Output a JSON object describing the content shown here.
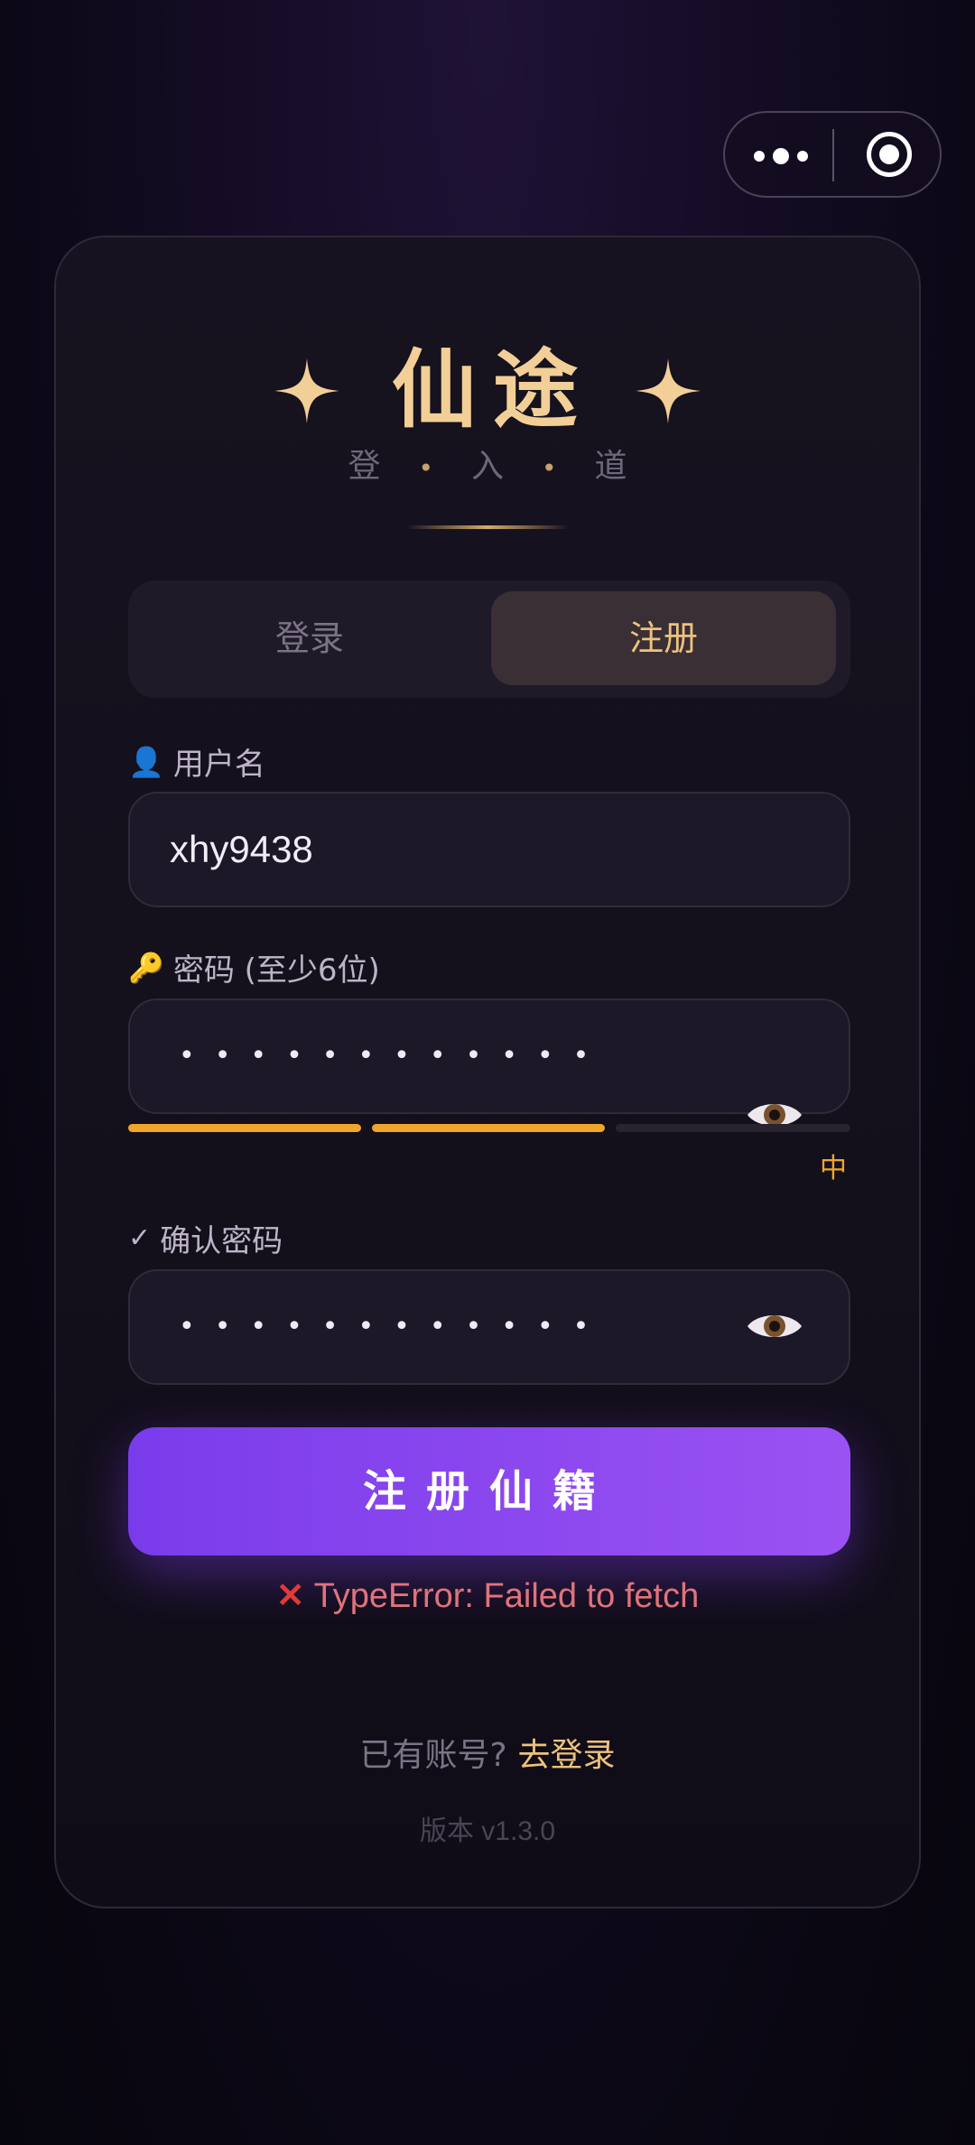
{
  "title": "仙途",
  "subtitle": [
    "登",
    "入",
    "道"
  ],
  "tabs": {
    "login": "登录",
    "register": "注册",
    "active": "register"
  },
  "username": {
    "label": "用户名",
    "value": "xhy9438"
  },
  "password": {
    "label": "密码 (至少6位)",
    "masked": "••••••••••••",
    "strength_label": "中",
    "strength_level": 2,
    "strength_max": 3
  },
  "confirm": {
    "label": "确认密码",
    "masked": "••••••••••••"
  },
  "submit_label": "注册仙籍",
  "error": "TypeError: Failed to fetch",
  "footer": {
    "prompt": "已有账号?",
    "link": "去登录"
  },
  "version": "版本 v1.3.0",
  "colors": {
    "accent_gold": "#f1cf96",
    "button": "#8a47f0",
    "strength": "#f0a52b",
    "error": "#e0737b"
  }
}
